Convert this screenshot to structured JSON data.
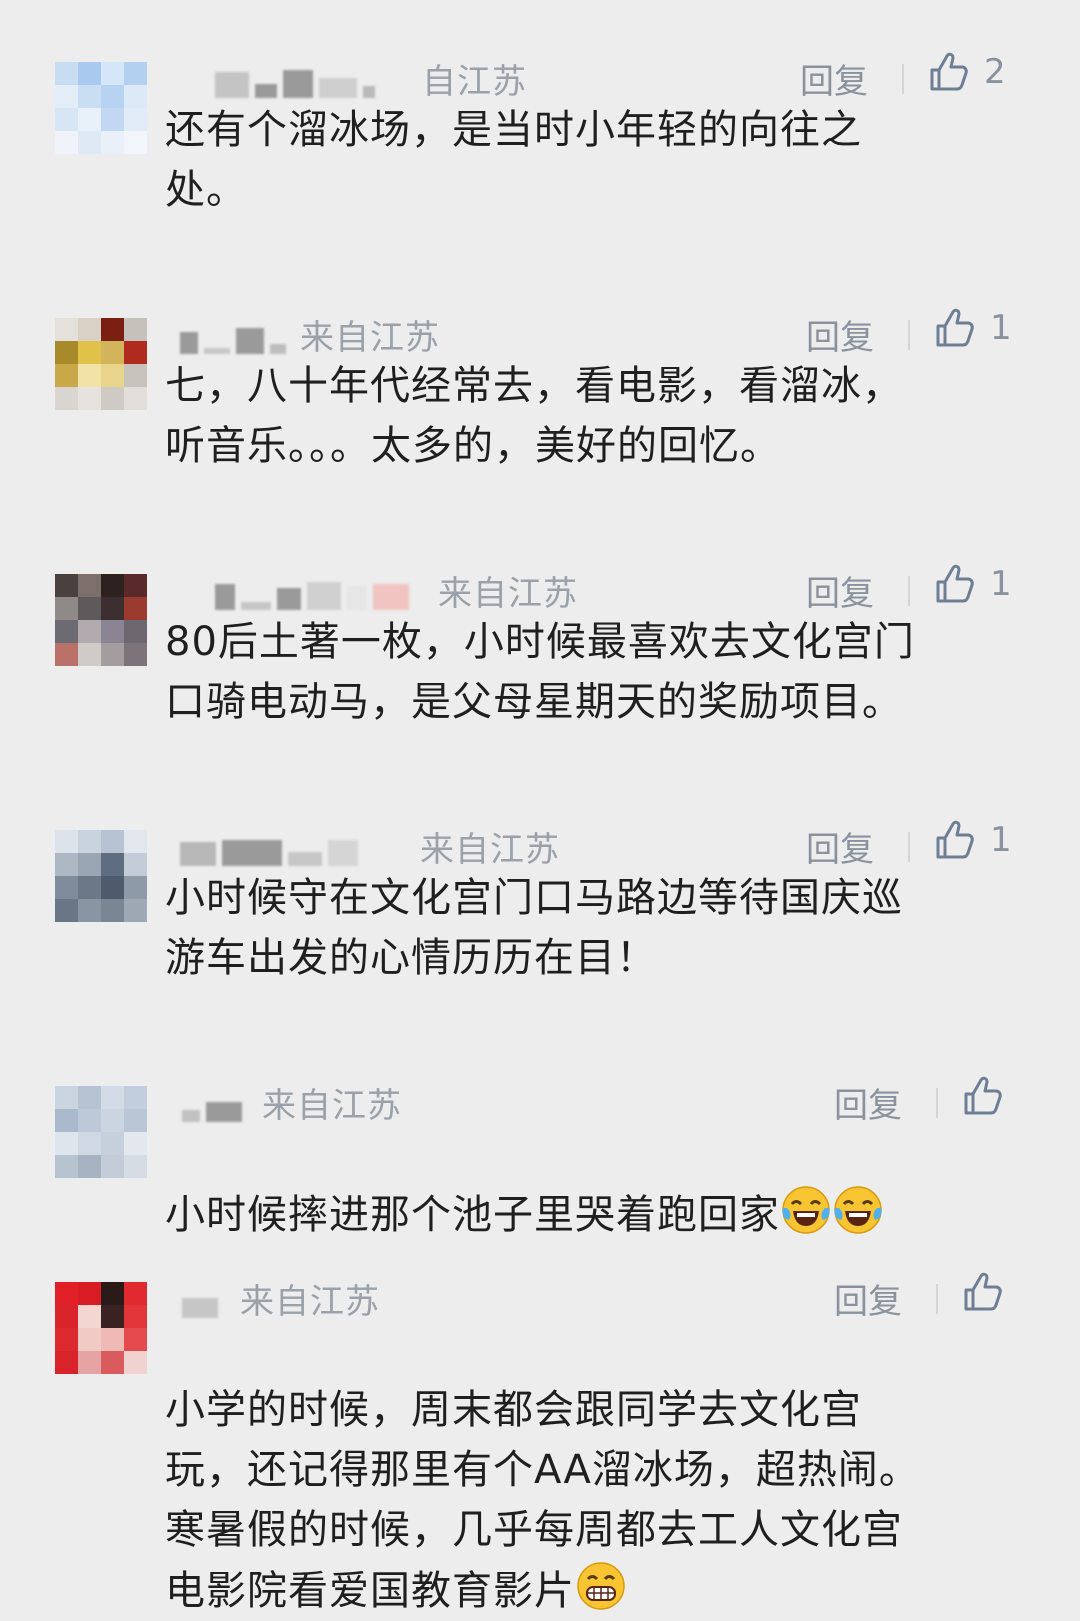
{
  "comments": [
    {
      "location": "来自江苏",
      "location_visible": "自江苏",
      "reply": "回复",
      "likes": "2",
      "text": "还有个溜冰场，是当时小年轻的向往之\n处。",
      "avatar_colors": [
        "#c8dcf2",
        "#a9c9ee",
        "#d4e6f7",
        "#b3d0f0",
        "#e3edf8",
        "#c9ddf3",
        "#b7d3f1",
        "#dce9f7",
        "#d7e6f5",
        "#e8f0f9",
        "#c2d8f2",
        "#e1ecf8",
        "#f0f4fa",
        "#dfe9f5",
        "#e9f0f8",
        "#f2f5fa"
      ]
    },
    {
      "location": "来自江苏",
      "reply": "回复",
      "likes": "1",
      "text": "七，八十年代经常去，看电影，看溜冰，\n听音乐。。。太多的，美好的回忆。",
      "avatar_colors": [
        "#e4e0da",
        "#d9d1c6",
        "#7a1f12",
        "#c5c1bb",
        "#a88a2a",
        "#e0c24a",
        "#d2b45a",
        "#b02a1e",
        "#c9a84a",
        "#f2e2a6",
        "#e8d48a",
        "#c7c2bb",
        "#d9d6d1",
        "#e6e3df",
        "#cfcac4",
        "#e2dfdb"
      ]
    },
    {
      "location": "来自江苏",
      "reply": "回复",
      "likes": "1",
      "text": "80后土著一枚，小时候最喜欢去文化宫门\n口骑电动马，是父母星期天的奖励项目。",
      "avatar_colors": [
        "#4a403e",
        "#7d6f6b",
        "#2e2220",
        "#5a2a2a",
        "#8f8a88",
        "#5e5a5c",
        "#3c2e30",
        "#9b3a2e",
        "#6c6a72",
        "#b3aab0",
        "#8a8592",
        "#6d6870",
        "#b9716a",
        "#cfcbc9",
        "#a39da0",
        "#7c7478"
      ]
    },
    {
      "location": "来自江苏",
      "location_visible": "来自江苏",
      "reply": "回复",
      "likes": "1",
      "text": "小时候守在文化宫门口马路边等待国庆巡\n游车出发的心情历历在目！",
      "avatar_colors": [
        "#dde3ea",
        "#c9d3de",
        "#b7c3d2",
        "#e2e7ed",
        "#aeb8c4",
        "#9aa6b4",
        "#5e6d80",
        "#c3ccd7",
        "#7f8c9c",
        "#6b7888",
        "#4d5b6d",
        "#8f9aa8",
        "#6a7585",
        "#8a95a3",
        "#7b8695",
        "#9ea8b5"
      ]
    },
    {
      "location": "来自江苏",
      "reply": "回复",
      "likes": "",
      "text": "小时候摔进那个池子里哭着跑回家",
      "emojis": [
        "laugh-cry-emoji",
        "laugh-cry-emoji"
      ],
      "avatar_colors": [
        "#c9d4e0",
        "#b5c3d3",
        "#d3dce6",
        "#c2cede",
        "#aab9cb",
        "#bdc9d8",
        "#cbd5e1",
        "#b9c6d6",
        "#dfe5ec",
        "#d0d9e3",
        "#c6d0dc",
        "#e2e8ee",
        "#b8c3d0",
        "#a7b3c2",
        "#c3ccd7",
        "#d5dce4"
      ]
    },
    {
      "location": "来自江苏",
      "reply": "回复",
      "likes": "",
      "text": "小学的时候，周末都会跟同学去文化宫\n玩，还记得那里有个AA溜冰场，超热闹。\n寒暑假的时候，几乎每周都去工人文化宫\n电影院看爱国教育影片",
      "emojis": [
        "grin-emoji"
      ],
      "avatar_colors": [
        "#e01f26",
        "#d81c24",
        "#2a1a1a",
        "#e02a30",
        "#d9242b",
        "#f3d6d2",
        "#3a2222",
        "#e2353a",
        "#dc2a2f",
        "#f1c9c5",
        "#efb9b6",
        "#e44a4e",
        "#d8232a",
        "#e5a3a3",
        "#d95b5e",
        "#f0d3d1"
      ]
    }
  ]
}
